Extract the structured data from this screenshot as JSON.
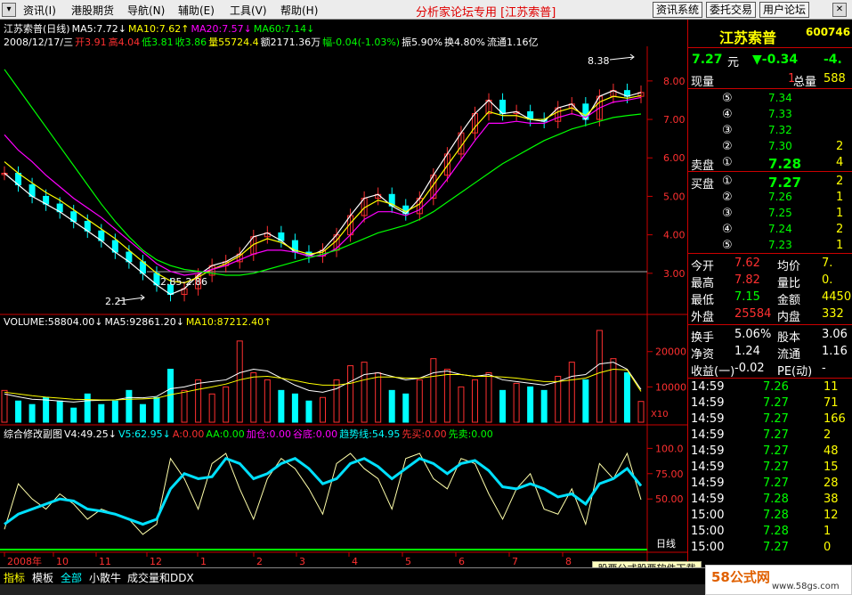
{
  "menu": {
    "items": [
      "资讯(I)",
      "港股期货",
      "导航(N)",
      "辅助(E)",
      "工具(V)",
      "帮助(H)"
    ],
    "forum_title": "分析家论坛专用 [江苏索普]",
    "buttons": [
      "资讯系统",
      "委托交易",
      "用户论坛"
    ]
  },
  "chart_header": {
    "line1": [
      {
        "text": "江苏索普(日线)",
        "color": "#ffffff"
      },
      {
        "text": "MA5:7.72↓",
        "color": "#ffffff"
      },
      {
        "text": "MA10:7.62↑",
        "color": "#ffff00"
      },
      {
        "text": "MA20:7.57↓",
        "color": "#ff00ff"
      },
      {
        "text": "MA60:7.14↓",
        "color": "#00ff00"
      }
    ],
    "line2": [
      {
        "text": "2008/12/17/三",
        "color": "#ffffff"
      },
      {
        "text": "开3.91",
        "color": "#ff3030"
      },
      {
        "text": "高4.04",
        "color": "#ff3030"
      },
      {
        "text": "低3.81",
        "color": "#00ff00"
      },
      {
        "text": "收3.86",
        "color": "#00ff00"
      },
      {
        "text": "量55724.4",
        "color": "#ffff00"
      },
      {
        "text": "额2171.36万",
        "color": "#ffffff"
      },
      {
        "text": "幅-0.04(-1.03%)",
        "color": "#00ff00"
      },
      {
        "text": "振5.90%",
        "color": "#ffffff"
      },
      {
        "text": "换4.80%",
        "color": "#ffffff"
      },
      {
        "text": "流通1.16亿",
        "color": "#ffffff"
      }
    ],
    "volume_line": [
      {
        "text": "VOLUME:58804.00↓",
        "color": "#ffffff"
      },
      {
        "text": "MA5:92861.20↓",
        "color": "#ffffff"
      },
      {
        "text": "MA10:87212.40↑",
        "color": "#ffff00"
      }
    ],
    "indicator_line": [
      {
        "text": "综合修改副图",
        "color": "#ffffff"
      },
      {
        "text": "V4:49.25↓",
        "color": "#ffffff"
      },
      {
        "text": "V5:62.95↓",
        "color": "#00ffff"
      },
      {
        "text": "A:0.00",
        "color": "#ff3030"
      },
      {
        "text": "AA:0.00",
        "color": "#00ff00"
      },
      {
        "text": "加仓:0.00",
        "color": "#ff00ff"
      },
      {
        "text": "谷底:0.00",
        "color": "#ff00ff"
      },
      {
        "text": "趋势线:54.95",
        "color": "#00ffff"
      },
      {
        "text": "先买:0.00",
        "color": "#ff3030"
      },
      {
        "text": "先卖:0.00",
        "color": "#00ff00"
      }
    ]
  },
  "price_axis": [
    "8.00",
    "7.00",
    "6.00",
    "5.00",
    "4.00",
    "3.00"
  ],
  "volume_axis": [
    "20000",
    "10000"
  ],
  "volume_unit": "X10",
  "indicator_axis": [
    "100.0",
    "75.00",
    "50.00"
  ],
  "annotations": {
    "high": "8.38",
    "low": "2.21",
    "range": "2.85-2.86"
  },
  "date_axis": [
    "2008年",
    "10",
    "11",
    "12",
    "1",
    "2",
    "3",
    "4",
    "5",
    "6",
    "7",
    "8"
  ],
  "period_label": "日线",
  "chart_data": [
    {
      "type": "line",
      "title": "江苏索普(日线)",
      "ylim": [
        2.0,
        8.9
      ],
      "series": [
        {
          "name": "MA5",
          "values": [
            5.6,
            5.3,
            5.0,
            4.8,
            4.6,
            4.35,
            4.1,
            3.85,
            3.55,
            3.3,
            3.0,
            2.7,
            2.45,
            2.6,
            2.95,
            3.2,
            3.3,
            3.5,
            3.95,
            4.05,
            3.85,
            3.55,
            3.45,
            3.6,
            4.0,
            4.5,
            4.95,
            5.05,
            4.75,
            4.55,
            4.95,
            5.55,
            6.1,
            6.65,
            7.15,
            7.5,
            7.15,
            7.2,
            7.0,
            6.95,
            7.3,
            7.4,
            7.0,
            7.6,
            7.75,
            7.6,
            7.7
          ]
        },
        {
          "name": "MA10",
          "values": [
            5.9,
            5.6,
            5.35,
            5.1,
            4.9,
            4.65,
            4.4,
            4.15,
            3.9,
            3.6,
            3.3,
            3.0,
            2.8,
            2.75,
            2.9,
            3.1,
            3.25,
            3.45,
            3.75,
            3.9,
            3.8,
            3.6,
            3.5,
            3.55,
            3.85,
            4.3,
            4.7,
            4.9,
            4.8,
            4.6,
            4.8,
            5.3,
            5.8,
            6.3,
            6.8,
            7.2,
            7.1,
            7.1,
            7.0,
            7.0,
            7.2,
            7.3,
            7.1,
            7.45,
            7.6,
            7.55,
            7.62
          ]
        },
        {
          "name": "MA20",
          "values": [
            6.6,
            6.2,
            5.9,
            5.55,
            5.25,
            4.95,
            4.7,
            4.45,
            4.15,
            3.85,
            3.55,
            3.25,
            3.05,
            2.95,
            3.0,
            3.1,
            3.2,
            3.35,
            3.5,
            3.6,
            3.6,
            3.55,
            3.45,
            3.45,
            3.65,
            4.0,
            4.4,
            4.6,
            4.6,
            4.5,
            4.65,
            5.0,
            5.45,
            5.95,
            6.45,
            6.9,
            6.9,
            6.95,
            6.9,
            6.9,
            7.05,
            7.15,
            7.05,
            7.3,
            7.45,
            7.5,
            7.57
          ]
        },
        {
          "name": "MA60",
          "values": [
            8.3,
            7.8,
            7.3,
            6.8,
            6.3,
            5.8,
            5.3,
            4.8,
            4.35,
            3.95,
            3.6,
            3.35,
            3.2,
            3.1,
            3.05,
            3.0,
            2.95,
            2.95,
            3.0,
            3.1,
            3.2,
            3.3,
            3.4,
            3.5,
            3.6,
            3.75,
            3.9,
            4.05,
            4.15,
            4.25,
            4.4,
            4.6,
            4.85,
            5.1,
            5.35,
            5.6,
            5.85,
            6.05,
            6.25,
            6.45,
            6.6,
            6.75,
            6.85,
            6.95,
            7.05,
            7.1,
            7.14
          ]
        }
      ]
    },
    {
      "type": "bar",
      "title": "VOLUME",
      "ylim": [
        0,
        27000
      ],
      "series": [
        {
          "name": "VOLUME",
          "values": [
            9000,
            6000,
            5000,
            7000,
            6000,
            4000,
            8000,
            5000,
            6000,
            9000,
            5000,
            7000,
            15000,
            9000,
            12000,
            8000,
            10000,
            23000,
            14000,
            12000,
            9000,
            8000,
            6000,
            7000,
            12000,
            16000,
            17000,
            14000,
            9000,
            8000,
            12000,
            18000,
            15000,
            10000,
            12000,
            14000,
            9000,
            11000,
            10000,
            9000,
            13000,
            17000,
            12000,
            26000,
            18000,
            14000,
            5880
          ]
        },
        {
          "name": "MA5",
          "values": [
            8000,
            7200,
            6500,
            6300,
            6000,
            5700,
            6100,
            6200,
            6300,
            7000,
            6900,
            7300,
            9500,
            10000,
            11000,
            11500,
            12000,
            14000,
            15000,
            14500,
            12500,
            10500,
            9000,
            8500,
            9500,
            11500,
            13500,
            14000,
            13000,
            12000,
            12500,
            14000,
            14500,
            13500,
            13000,
            13500,
            12000,
            11500,
            11000,
            10500,
            11500,
            13000,
            13500,
            16500,
            17000,
            15000,
            9286
          ]
        },
        {
          "name": "MA10",
          "values": [
            8500,
            8000,
            7500,
            7100,
            6800,
            6500,
            6400,
            6300,
            6300,
            6500,
            6600,
            6800,
            7800,
            8500,
            9300,
            10000,
            10800,
            12000,
            12800,
            13000,
            12500,
            11800,
            11000,
            10500,
            10500,
            11000,
            12000,
            12800,
            12800,
            12500,
            12500,
            13000,
            13500,
            13500,
            13000,
            13000,
            12800,
            12500,
            12000,
            11500,
            11500,
            12000,
            12500,
            14000,
            15000,
            14800,
            8721
          ]
        }
      ]
    },
    {
      "type": "line",
      "title": "综合修改副图",
      "ylim": [
        0,
        110
      ],
      "series": [
        {
          "name": "V4",
          "values": [
            20,
            65,
            50,
            40,
            55,
            45,
            30,
            40,
            35,
            30,
            15,
            25,
            90,
            70,
            40,
            85,
            95,
            60,
            30,
            70,
            90,
            80,
            60,
            35,
            85,
            95,
            80,
            70,
            40,
            90,
            95,
            70,
            60,
            90,
            85,
            55,
            30,
            60,
            75,
            40,
            35,
            60,
            25,
            85,
            70,
            95,
            49.25
          ]
        },
        {
          "name": "V5",
          "values": [
            25,
            35,
            40,
            45,
            50,
            48,
            40,
            38,
            35,
            30,
            25,
            30,
            60,
            75,
            70,
            72,
            90,
            85,
            70,
            75,
            85,
            90,
            80,
            65,
            70,
            85,
            90,
            82,
            70,
            80,
            90,
            85,
            75,
            85,
            88,
            78,
            62,
            60,
            65,
            60,
            52,
            55,
            45,
            65,
            70,
            80,
            62.95
          ]
        }
      ]
    }
  ],
  "quote": {
    "name": "江苏索普",
    "code": "600746",
    "price": "7.27",
    "unit": "元",
    "change": "▼-0.34",
    "change_pct": "-4.",
    "current_vol_label": "现量",
    "current_vol": "1",
    "total_vol_label": "总量",
    "total_vol": "588",
    "sell_label": "卖盘",
    "buy_label": "买盘",
    "asks": [
      {
        "level": "⑤",
        "price": "7.34",
        "vol": ""
      },
      {
        "level": "④",
        "price": "7.33",
        "vol": ""
      },
      {
        "level": "③",
        "price": "7.32",
        "vol": ""
      },
      {
        "level": "②",
        "price": "7.30",
        "vol": "2"
      },
      {
        "level": "①",
        "price": "7.28",
        "vol": "4"
      }
    ],
    "bids": [
      {
        "level": "①",
        "price": "7.27",
        "vol": "2"
      },
      {
        "level": "②",
        "price": "7.26",
        "vol": "1"
      },
      {
        "level": "③",
        "price": "7.25",
        "vol": "1"
      },
      {
        "level": "④",
        "price": "7.24",
        "vol": "2"
      },
      {
        "level": "⑤",
        "price": "7.23",
        "vol": "1"
      }
    ],
    "stats": [
      {
        "l1": "今开",
        "v1": "7.62",
        "c1": "#ff3030",
        "l2": "均价",
        "v2": "7."
      },
      {
        "l1": "最高",
        "v1": "7.82",
        "c1": "#ff3030",
        "l2": "量比",
        "v2": "0."
      },
      {
        "l1": "最低",
        "v1": "7.15",
        "c1": "#00ff00",
        "l2": "金额",
        "v2": "4450"
      },
      {
        "l1": "外盘",
        "v1": "25584",
        "c1": "#ff3030",
        "l2": "内盘",
        "v2": "332"
      }
    ],
    "stats2": [
      {
        "l1": "换手",
        "v1": "5.06%",
        "l2": "股本",
        "v2": "3.06"
      },
      {
        "l1": "净资",
        "v1": "1.24",
        "l2": "流通",
        "v2": "1.16"
      },
      {
        "l1": "收益(一)",
        "v1": "-0.02",
        "l2": "PE(动)",
        "v2": "-"
      }
    ],
    "ticks": [
      {
        "time": "14:59",
        "price": "7.26",
        "vol": "11"
      },
      {
        "time": "14:59",
        "price": "7.27",
        "vol": "71"
      },
      {
        "time": "14:59",
        "price": "7.27",
        "vol": "166"
      },
      {
        "time": "14:59",
        "price": "7.27",
        "vol": "2"
      },
      {
        "time": "14:59",
        "price": "7.27",
        "vol": "48"
      },
      {
        "time": "14:59",
        "price": "7.27",
        "vol": "15"
      },
      {
        "time": "14:59",
        "price": "7.27",
        "vol": "28"
      },
      {
        "time": "14:59",
        "price": "7.28",
        "vol": "38"
      },
      {
        "time": "15:00",
        "price": "7.28",
        "vol": "12"
      },
      {
        "time": "15:00",
        "price": "7.28",
        "vol": "1"
      },
      {
        "time": "15:00",
        "price": "7.27",
        "vol": "0"
      }
    ]
  },
  "bottom_tabs": [
    "指标",
    "模板",
    "全部",
    "小散牛",
    "成交量和DDX"
  ],
  "ad_text": "股票公式股票软件下载",
  "logo": {
    "main": "58公式网",
    "sub": "www.58gs.com"
  },
  "colors": {
    "up": "#ff3030",
    "down": "#00ffff",
    "ma5": "#ffffff",
    "ma10": "#ffff00",
    "ma20": "#ff00ff",
    "ma60": "#00ff00",
    "panel_border": "#cc0000"
  }
}
